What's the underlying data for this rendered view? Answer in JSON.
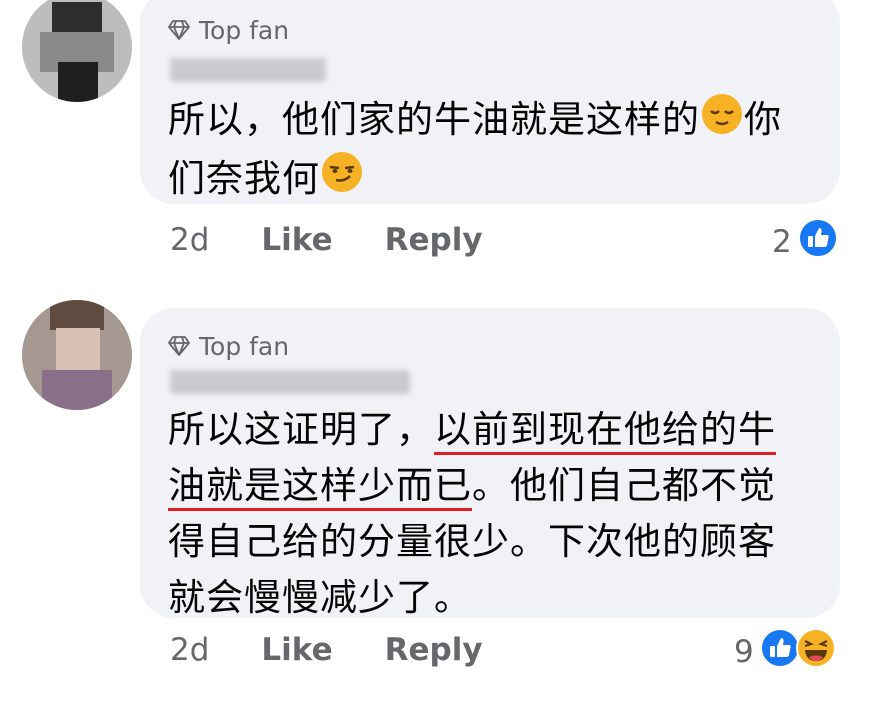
{
  "comments": [
    {
      "badge": "Top fan",
      "text_parts": [
        "所以，他们家的牛油就是这样的",
        "你们奈我何",
        ""
      ],
      "emojis": [
        "relieved-face",
        "smirking-face"
      ],
      "time": "2d",
      "like_label": "Like",
      "reply_label": "Reply",
      "reaction_count": "2",
      "reactions": [
        "like"
      ]
    },
    {
      "badge": "Top fan",
      "text_before": "所以这证明了，",
      "text_underlined": "以前到现在他给的牛油就是这样少而已",
      "text_after": "。他们自己都不觉得自己给的分量很少。下次他的顾客就会慢慢减少了。",
      "time": "2d",
      "like_label": "Like",
      "reply_label": "Reply",
      "reaction_count": "9",
      "reactions": [
        "like",
        "haha"
      ]
    }
  ],
  "colors": {
    "bubble": "#f0f2f5",
    "meta_text": "#65676b",
    "like_blue": "#1877f2",
    "underline_red": "#e01b24",
    "haha_yellow": "#f7b125"
  }
}
